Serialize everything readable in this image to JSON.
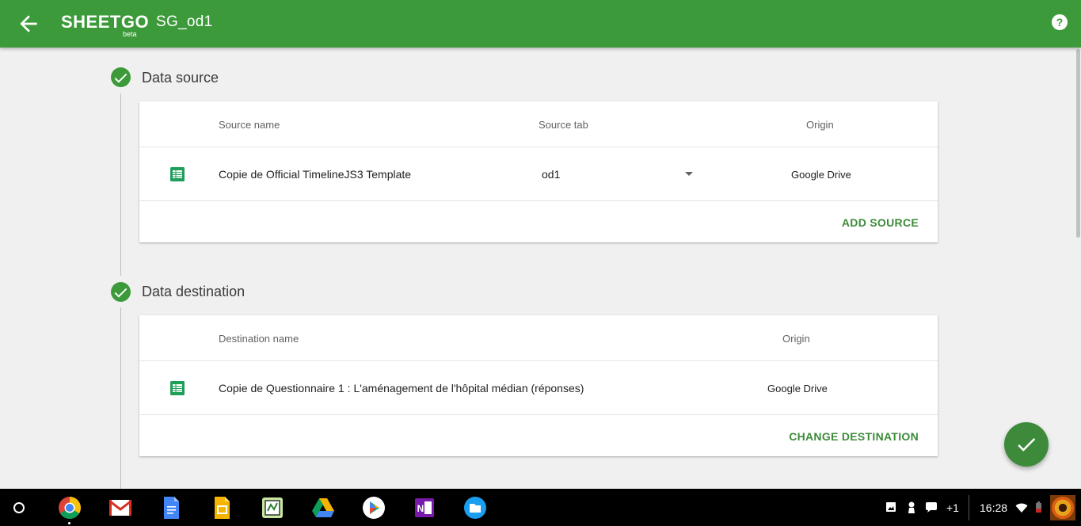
{
  "header": {
    "logo_text": "SHEETGO",
    "logo_beta": "beta",
    "title": "SG_od1",
    "back_icon": "arrow-back-icon",
    "help_icon": "help-icon",
    "color": "#3d9a3a"
  },
  "source": {
    "step_label": "Data source",
    "columns": [
      "Source name",
      "Source tab",
      "Origin"
    ],
    "row": {
      "name": "Copie de Official TimelineJS3 Template",
      "tab": "od1",
      "origin": "Google Drive"
    },
    "action": "ADD SOURCE"
  },
  "destination": {
    "step_label": "Data destination",
    "columns": [
      "Destination name",
      "Origin"
    ],
    "row": {
      "name": "Copie de Questionnaire 1 : L'aménagement de l'hôpital médian (réponses)",
      "origin": "Google Drive"
    },
    "action": "CHANGE DESTINATION"
  },
  "fab_icon": "check-icon",
  "taskbar": {
    "apps": [
      "chrome-icon",
      "gmail-icon",
      "docs-icon",
      "slides-icon",
      "sheetgo-app-icon",
      "drive-icon",
      "play-store-icon",
      "onenote-icon",
      "files-icon"
    ],
    "notification_count": "+1",
    "time": "16:28"
  }
}
